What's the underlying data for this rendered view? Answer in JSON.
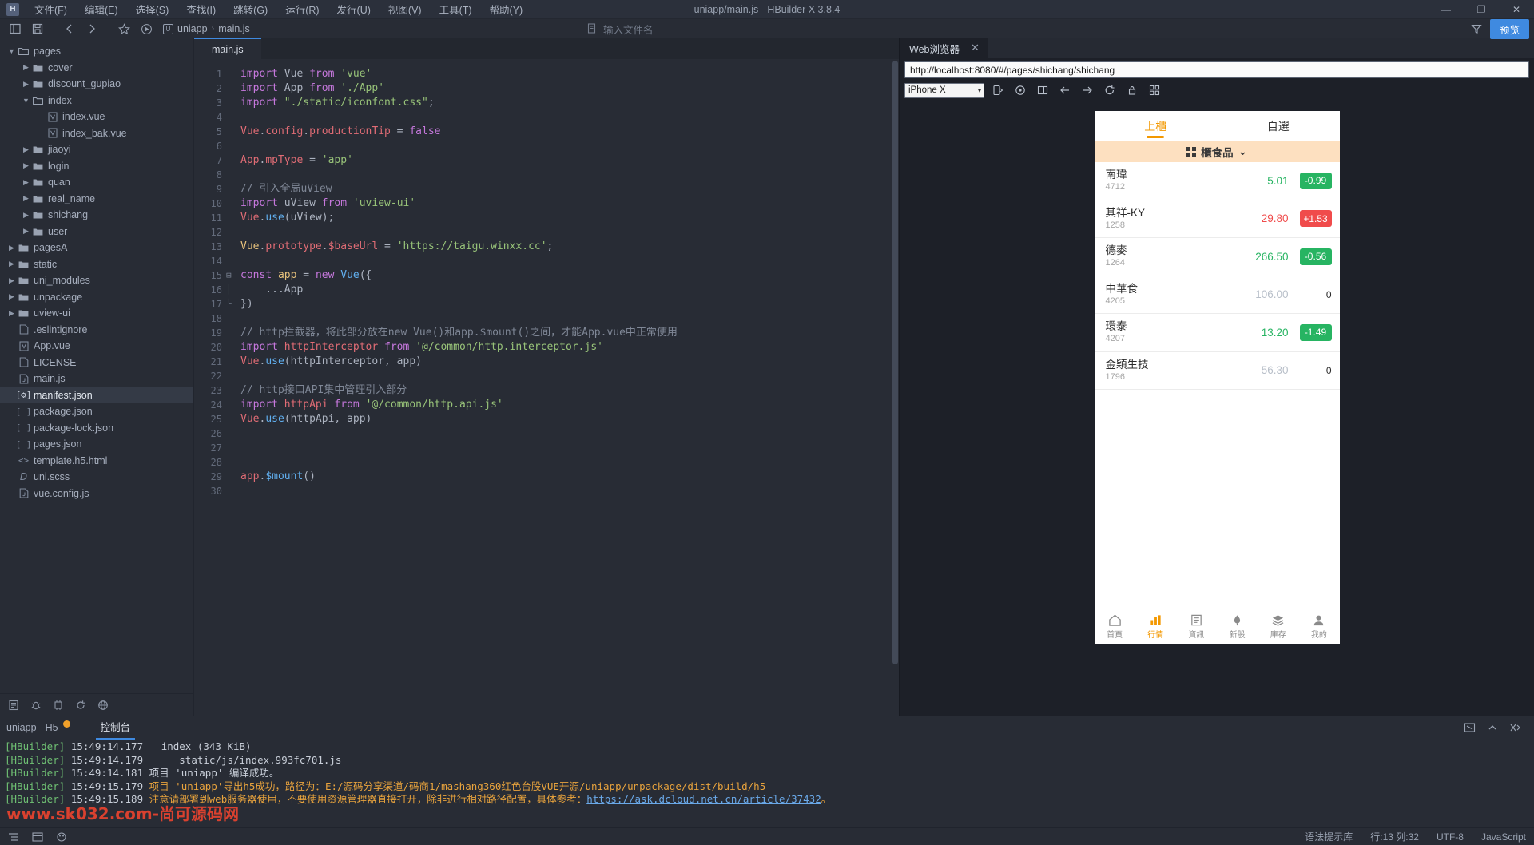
{
  "window": {
    "title": "uniapp/main.js - HBuilder X 3.8.4",
    "logo": "H",
    "minimize": "—",
    "maximize": "❐",
    "close": "✕"
  },
  "menubar": {
    "items": [
      {
        "label": "文件(F)"
      },
      {
        "label": "编辑(E)"
      },
      {
        "label": "选择(S)"
      },
      {
        "label": "查找(I)"
      },
      {
        "label": "跳转(G)"
      },
      {
        "label": "运行(R)"
      },
      {
        "label": "发行(U)"
      },
      {
        "label": "视图(V)"
      },
      {
        "label": "工具(T)"
      },
      {
        "label": "帮助(Y)"
      }
    ]
  },
  "toolbar": {
    "breadcrumb": {
      "project": "uniapp",
      "file": "main.js",
      "separator": "›"
    },
    "filename_placeholder": "输入文件名",
    "preview_label": "预览"
  },
  "tree": {
    "items": [
      {
        "indent": 1,
        "arrow": "down",
        "icon": "folder-open",
        "label": "pages",
        "selected": false
      },
      {
        "indent": 2,
        "arrow": "right",
        "icon": "folder",
        "label": "cover",
        "selected": false
      },
      {
        "indent": 2,
        "arrow": "right",
        "icon": "folder",
        "label": "discount_gupiao",
        "selected": false
      },
      {
        "indent": 2,
        "arrow": "down",
        "icon": "folder-open",
        "label": "index",
        "selected": false
      },
      {
        "indent": 3,
        "arrow": "none",
        "icon": "vue",
        "label": "index.vue",
        "selected": false
      },
      {
        "indent": 3,
        "arrow": "none",
        "icon": "vue",
        "label": "index_bak.vue",
        "selected": false
      },
      {
        "indent": 2,
        "arrow": "right",
        "icon": "folder",
        "label": "jiaoyi",
        "selected": false
      },
      {
        "indent": 2,
        "arrow": "right",
        "icon": "folder",
        "label": "login",
        "selected": false
      },
      {
        "indent": 2,
        "arrow": "right",
        "icon": "folder",
        "label": "quan",
        "selected": false
      },
      {
        "indent": 2,
        "arrow": "right",
        "icon": "folder",
        "label": "real_name",
        "selected": false
      },
      {
        "indent": 2,
        "arrow": "right",
        "icon": "folder",
        "label": "shichang",
        "selected": false
      },
      {
        "indent": 2,
        "arrow": "right",
        "icon": "folder",
        "label": "user",
        "selected": false
      },
      {
        "indent": 1,
        "arrow": "right",
        "icon": "folder",
        "label": "pagesA",
        "selected": false
      },
      {
        "indent": 1,
        "arrow": "right",
        "icon": "folder",
        "label": "static",
        "selected": false
      },
      {
        "indent": 1,
        "arrow": "right",
        "icon": "folder",
        "label": "uni_modules",
        "selected": false
      },
      {
        "indent": 1,
        "arrow": "right",
        "icon": "folder",
        "label": "unpackage",
        "selected": false
      },
      {
        "indent": 1,
        "arrow": "right",
        "icon": "folder",
        "label": "uview-ui",
        "selected": false
      },
      {
        "indent": 1,
        "arrow": "none",
        "icon": "file",
        "label": ".eslintignore",
        "selected": false
      },
      {
        "indent": 1,
        "arrow": "none",
        "icon": "vue",
        "label": "App.vue",
        "selected": false
      },
      {
        "indent": 1,
        "arrow": "none",
        "icon": "file",
        "label": "LICENSE",
        "selected": false
      },
      {
        "indent": 1,
        "arrow": "none",
        "icon": "js",
        "label": "main.js",
        "selected": false
      },
      {
        "indent": 1,
        "arrow": "none",
        "icon": "json-gear",
        "label": "manifest.json",
        "selected": true
      },
      {
        "indent": 1,
        "arrow": "none",
        "icon": "json",
        "label": "package.json",
        "selected": false
      },
      {
        "indent": 1,
        "arrow": "none",
        "icon": "json",
        "label": "package-lock.json",
        "selected": false
      },
      {
        "indent": 1,
        "arrow": "none",
        "icon": "json",
        "label": "pages.json",
        "selected": false
      },
      {
        "indent": 1,
        "arrow": "none",
        "icon": "html",
        "label": "template.h5.html",
        "selected": false
      },
      {
        "indent": 1,
        "arrow": "none",
        "icon": "scss",
        "label": "uni.scss",
        "selected": false
      },
      {
        "indent": 1,
        "arrow": "none",
        "icon": "js",
        "label": "vue.config.js",
        "selected": false
      }
    ]
  },
  "editor": {
    "tab_label": "main.js",
    "lines": [
      {
        "n": 1,
        "fold": "",
        "tokens": [
          {
            "t": "import",
            "c": "kw"
          },
          {
            "t": " Vue ",
            "c": "pun"
          },
          {
            "t": "from",
            "c": "kw"
          },
          {
            "t": " ",
            "c": "pun"
          },
          {
            "t": "'vue'",
            "c": "str"
          }
        ]
      },
      {
        "n": 2,
        "fold": "",
        "tokens": [
          {
            "t": "import",
            "c": "kw"
          },
          {
            "t": " App ",
            "c": "pun"
          },
          {
            "t": "from",
            "c": "kw"
          },
          {
            "t": " ",
            "c": "pun"
          },
          {
            "t": "'./App'",
            "c": "str"
          }
        ]
      },
      {
        "n": 3,
        "fold": "",
        "tokens": [
          {
            "t": "import",
            "c": "kw"
          },
          {
            "t": " ",
            "c": "pun"
          },
          {
            "t": "\"./static/iconfont.css\"",
            "c": "str"
          },
          {
            "t": ";",
            "c": "pun"
          }
        ]
      },
      {
        "n": 4,
        "fold": "",
        "tokens": []
      },
      {
        "n": 5,
        "fold": "",
        "tokens": [
          {
            "t": "Vue",
            "c": "var"
          },
          {
            "t": ".",
            "c": "pun"
          },
          {
            "t": "config",
            "c": "var"
          },
          {
            "t": ".",
            "c": "pun"
          },
          {
            "t": "productionTip",
            "c": "var"
          },
          {
            "t": " = ",
            "c": "pun"
          },
          {
            "t": "false",
            "c": "kw"
          }
        ]
      },
      {
        "n": 6,
        "fold": "",
        "tokens": []
      },
      {
        "n": 7,
        "fold": "",
        "tokens": [
          {
            "t": "App",
            "c": "var"
          },
          {
            "t": ".",
            "c": "pun"
          },
          {
            "t": "mpType",
            "c": "var"
          },
          {
            "t": " = ",
            "c": "pun"
          },
          {
            "t": "'app'",
            "c": "str"
          }
        ]
      },
      {
        "n": 8,
        "fold": "",
        "tokens": []
      },
      {
        "n": 9,
        "fold": "",
        "tokens": [
          {
            "t": "// 引入全局uView",
            "c": "cmt"
          }
        ]
      },
      {
        "n": 10,
        "fold": "",
        "tokens": [
          {
            "t": "import",
            "c": "kw"
          },
          {
            "t": " uView ",
            "c": "pun"
          },
          {
            "t": "from",
            "c": "kw"
          },
          {
            "t": " ",
            "c": "pun"
          },
          {
            "t": "'uview-ui'",
            "c": "str"
          }
        ]
      },
      {
        "n": 11,
        "fold": "",
        "tokens": [
          {
            "t": "Vue",
            "c": "var"
          },
          {
            "t": ".",
            "c": "pun"
          },
          {
            "t": "use",
            "c": "fn"
          },
          {
            "t": "(uView);",
            "c": "pun"
          }
        ]
      },
      {
        "n": 12,
        "fold": "",
        "tokens": []
      },
      {
        "n": 13,
        "fold": "",
        "tokens": [
          {
            "t": "Vue",
            "c": "yel"
          },
          {
            "t": ".",
            "c": "pun"
          },
          {
            "t": "prototype",
            "c": "var"
          },
          {
            "t": ".",
            "c": "pun"
          },
          {
            "t": "$baseUrl",
            "c": "var"
          },
          {
            "t": " = ",
            "c": "pun"
          },
          {
            "t": "'https://taigu.winxx.cc'",
            "c": "str"
          },
          {
            "t": ";",
            "c": "pun"
          }
        ]
      },
      {
        "n": 14,
        "fold": "",
        "tokens": []
      },
      {
        "n": 15,
        "fold": "⊟",
        "tokens": [
          {
            "t": "const",
            "c": "kw"
          },
          {
            "t": " ",
            "c": "pun"
          },
          {
            "t": "app",
            "c": "yel"
          },
          {
            "t": " = ",
            "c": "pun"
          },
          {
            "t": "new",
            "c": "kw"
          },
          {
            "t": " ",
            "c": "pun"
          },
          {
            "t": "Vue",
            "c": "fn"
          },
          {
            "t": "({",
            "c": "pun"
          }
        ]
      },
      {
        "n": 16,
        "fold": "│",
        "tokens": [
          {
            "t": "    ...App",
            "c": "pun"
          }
        ]
      },
      {
        "n": 17,
        "fold": "└",
        "tokens": [
          {
            "t": "})",
            "c": "pun"
          }
        ]
      },
      {
        "n": 18,
        "fold": "",
        "tokens": []
      },
      {
        "n": 19,
        "fold": "",
        "tokens": [
          {
            "t": "// http拦截器，将此部分放在new Vue()和app.$mount()之间，才能App.vue中正常使用",
            "c": "cmt"
          }
        ]
      },
      {
        "n": 20,
        "fold": "",
        "tokens": [
          {
            "t": "import",
            "c": "kw"
          },
          {
            "t": " httpInterceptor ",
            "c": "var"
          },
          {
            "t": "from",
            "c": "kw"
          },
          {
            "t": " ",
            "c": "pun"
          },
          {
            "t": "'@/common/http.interceptor.js'",
            "c": "str"
          }
        ]
      },
      {
        "n": 21,
        "fold": "",
        "tokens": [
          {
            "t": "Vue",
            "c": "var"
          },
          {
            "t": ".",
            "c": "pun"
          },
          {
            "t": "use",
            "c": "fn"
          },
          {
            "t": "(httpInterceptor, app)",
            "c": "pun"
          }
        ]
      },
      {
        "n": 22,
        "fold": "",
        "tokens": []
      },
      {
        "n": 23,
        "fold": "",
        "tokens": [
          {
            "t": "// http接口API集中管理引入部分",
            "c": "cmt"
          }
        ]
      },
      {
        "n": 24,
        "fold": "",
        "tokens": [
          {
            "t": "import",
            "c": "kw"
          },
          {
            "t": " httpApi ",
            "c": "var"
          },
          {
            "t": "from",
            "c": "kw"
          },
          {
            "t": " ",
            "c": "pun"
          },
          {
            "t": "'@/common/http.api.js'",
            "c": "str"
          }
        ]
      },
      {
        "n": 25,
        "fold": "",
        "tokens": [
          {
            "t": "Vue",
            "c": "var"
          },
          {
            "t": ".",
            "c": "pun"
          },
          {
            "t": "use",
            "c": "fn"
          },
          {
            "t": "(httpApi, app)",
            "c": "pun"
          }
        ]
      },
      {
        "n": 26,
        "fold": "",
        "tokens": []
      },
      {
        "n": 27,
        "fold": "",
        "tokens": []
      },
      {
        "n": 28,
        "fold": "",
        "tokens": []
      },
      {
        "n": 29,
        "fold": "",
        "tokens": [
          {
            "t": "app",
            "c": "var"
          },
          {
            "t": ".",
            "c": "pun"
          },
          {
            "t": "$mount",
            "c": "fn"
          },
          {
            "t": "()",
            "c": "pun"
          }
        ]
      },
      {
        "n": 30,
        "fold": "",
        "tokens": []
      }
    ]
  },
  "preview": {
    "tab_label": "Web浏览器",
    "tab_close": "✕",
    "url": "http://localhost:8080/#/pages/shichang/shichang",
    "device": "iPhone X",
    "caret": "▾",
    "phone": {
      "tabs": [
        {
          "label": "上櫃",
          "active": true
        },
        {
          "label": "自選",
          "active": false
        }
      ],
      "category": {
        "label": "櫃食品",
        "caret": "⌄"
      },
      "stocks": [
        {
          "name": "南瑋",
          "code": "4712",
          "price": "5.01",
          "change": "-0.99",
          "dir": "down"
        },
        {
          "name": "其祥-KY",
          "code": "1258",
          "price": "29.80",
          "change": "+1.53",
          "dir": "up"
        },
        {
          "name": "德麥",
          "code": "1264",
          "price": "266.50",
          "change": "-0.56",
          "dir": "down"
        },
        {
          "name": "中華食",
          "code": "4205",
          "price": "106.00",
          "change": "0",
          "dir": "flat"
        },
        {
          "name": "環泰",
          "code": "4207",
          "price": "13.20",
          "change": "-1.49",
          "dir": "down"
        },
        {
          "name": "金穎生技",
          "code": "1796",
          "price": "56.30",
          "change": "0",
          "dir": "flat"
        }
      ],
      "bottom_tabs": [
        {
          "label": "首頁",
          "icon": "⌂",
          "active": false
        },
        {
          "label": "行情",
          "icon": "Ὄ8",
          "active": true
        },
        {
          "label": "資訊",
          "icon": "☰",
          "active": false
        },
        {
          "label": "新股",
          "icon": "⚑",
          "active": false
        },
        {
          "label": "庫存",
          "icon": "≣",
          "active": false
        },
        {
          "label": "我的",
          "icon": "☺",
          "active": false
        }
      ]
    }
  },
  "console": {
    "project_label": "uniapp - H5",
    "tab_label": "控制台",
    "lines": [
      {
        "tag": "[HBuilder]",
        "time": "15:49:14.177",
        "segs": [
          {
            "t": "  index (343 KiB)",
            "c": "c-txt"
          }
        ]
      },
      {
        "tag": "[HBuilder]",
        "time": "15:49:14.179",
        "segs": [
          {
            "t": "     static/js/index.993fc701.js",
            "c": "c-txt"
          }
        ]
      },
      {
        "tag": "[HBuilder]",
        "time": "15:49:14.181",
        "segs": [
          {
            "t": "项目 'uniapp' 编译成功。",
            "c": "c-txt"
          }
        ]
      },
      {
        "tag": "[HBuilder]",
        "time": "15:49:15.179",
        "segs": [
          {
            "t": "项目 'uniapp'导出h5成功，路径为：",
            "c": "c-orange"
          },
          {
            "t": "E:/源码分享渠道/码商1/mashang360红色台股VUE开源/uniapp/unpackage/dist/build/h5",
            "c": "c-link"
          }
        ]
      },
      {
        "tag": "[HBuilder]",
        "time": "15:49:15.189",
        "segs": [
          {
            "t": "注意请部署到web服务器使用，不要使用资源管理器直接打开，除非进行相对路径配置，具体参考：",
            "c": "c-orange"
          },
          {
            "t": "https://ask.dcloud.net.cn/article/37432",
            "c": "c-blue"
          },
          {
            "t": "。",
            "c": "c-orange"
          }
        ]
      }
    ]
  },
  "watermark": {
    "text": "www.sk032.com-尚可源码网"
  },
  "statusbar": {
    "hint": "语法提示库",
    "position": "行:13 列:32",
    "encoding": "UTF-8",
    "language": "JavaScript"
  }
}
